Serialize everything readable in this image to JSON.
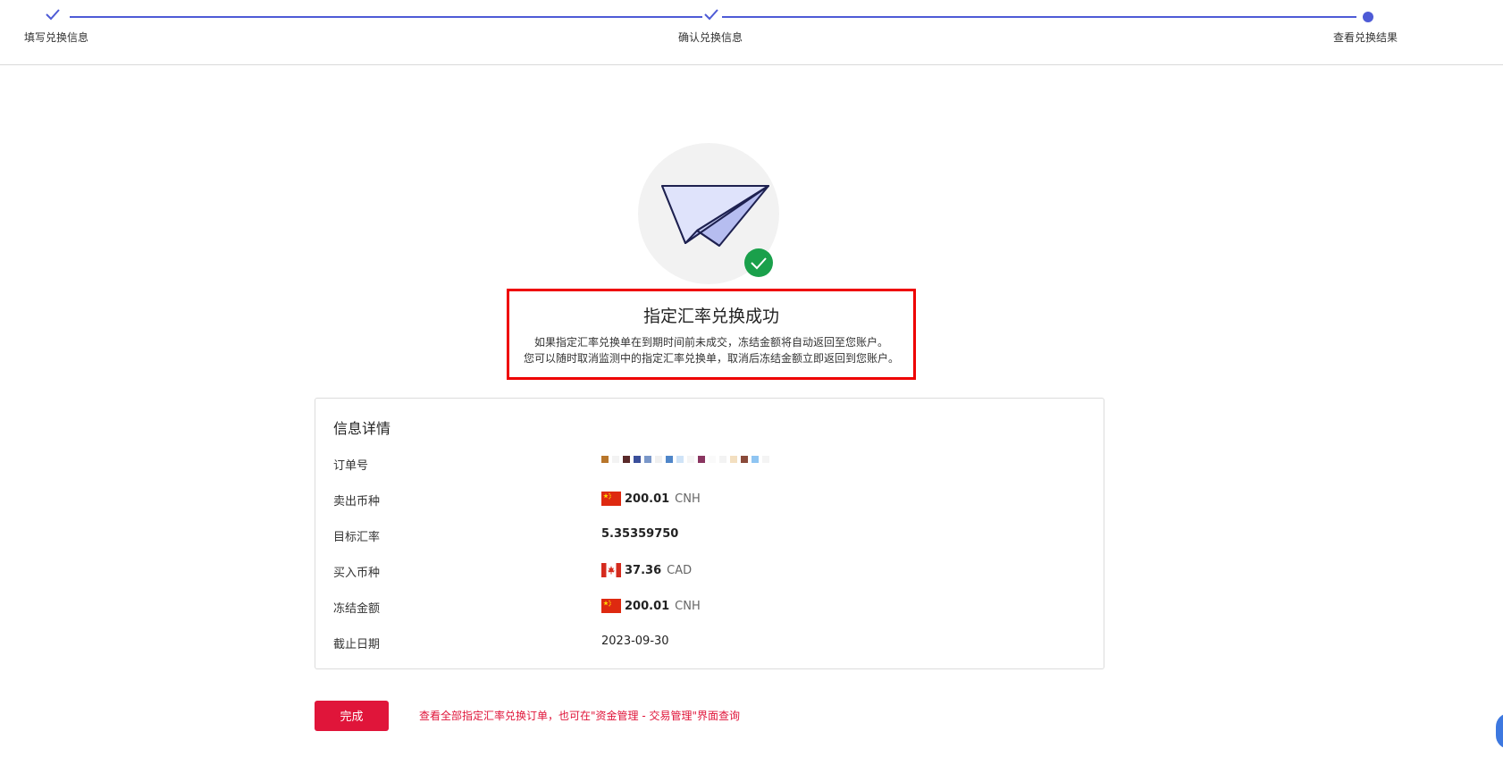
{
  "steps": [
    {
      "label": "填写兑换信息",
      "state": "done"
    },
    {
      "label": "确认兑换信息",
      "state": "done"
    },
    {
      "label": "查看兑换结果",
      "state": "current"
    }
  ],
  "colors": {
    "accent": "#4e5bd6",
    "brand": "#e0153a",
    "success": "#1aa04b",
    "highlight": "#ee0000"
  },
  "result": {
    "icon": "paper-plane-icon",
    "title": "指定汇率兑换成功",
    "line1": "如果指定汇率兑换单在到期时间前未成交，冻结金额将自动返回至您账户。",
    "line2": "您可以随时取消监测中的指定汇率兑换单，取消后冻结金额立即返回到您账户。"
  },
  "details": {
    "title": "信息详情",
    "order_no_label": "订单号",
    "sell_label": "卖出币种",
    "sell_amount": "200.01",
    "sell_currency": "CNH",
    "rate_label": "目标汇率",
    "rate_value": "5.35359750",
    "buy_label": "买入币种",
    "buy_amount": "37.36",
    "buy_currency": "CAD",
    "frozen_label": "冻结金额",
    "frozen_amount": "200.01",
    "frozen_currency": "CNH",
    "deadline_label": "截止日期",
    "deadline_value": "2023-09-30"
  },
  "footer": {
    "done_label": "完成",
    "hint": "查看全部指定汇率兑换订单，也可在\"资金管理 - 交易管理\"界面查询"
  }
}
